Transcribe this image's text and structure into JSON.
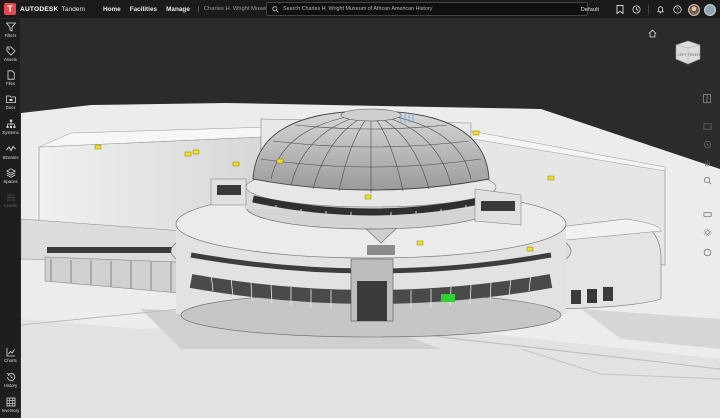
{
  "app": {
    "brand_mark": "T",
    "brand_name": "AUTODESK",
    "product_name": "Tandem"
  },
  "nav": {
    "home": "Home",
    "facilities": "Facilities",
    "manage": "Manage",
    "breadcrumb": "Charles H. Wright Museum of ..."
  },
  "search": {
    "placeholder": "Search Charles H. Wright Museum of African American History"
  },
  "top_right": {
    "view_label": "Default",
    "icons": [
      "bookmark-icon",
      "history-clock-icon",
      "notifications-bell-icon",
      "help-icon"
    ]
  },
  "sidebar": {
    "top_items": [
      {
        "label": "Filters",
        "icon": "filter-funnel-icon"
      },
      {
        "label": "Assets",
        "icon": "tag-icon"
      },
      {
        "label": "Files",
        "icon": "file-icon"
      },
      {
        "label": "Docs",
        "icon": "folder-icon"
      },
      {
        "label": "Systems",
        "icon": "systems-tree-icon"
      },
      {
        "label": "Streams",
        "icon": "stream-wave-icon"
      },
      {
        "label": "Spaces",
        "icon": "cube-layers-icon"
      },
      {
        "label": "Levels",
        "icon": "levels-icon"
      }
    ],
    "bottom_items": [
      {
        "label": "Charts",
        "icon": "chart-icon"
      },
      {
        "label": "History",
        "icon": "history-icon"
      },
      {
        "label": "Inventory",
        "icon": "grid-icon"
      }
    ]
  },
  "viewer": {
    "viewcube_faces": [
      "LEFT",
      "FRONT"
    ],
    "background_color": "#2b2b2b",
    "ground_color": "#ececec",
    "building_color": "#e3e3e3",
    "highlight_color": "#2fd12f",
    "marker_color": "#f0e020"
  }
}
